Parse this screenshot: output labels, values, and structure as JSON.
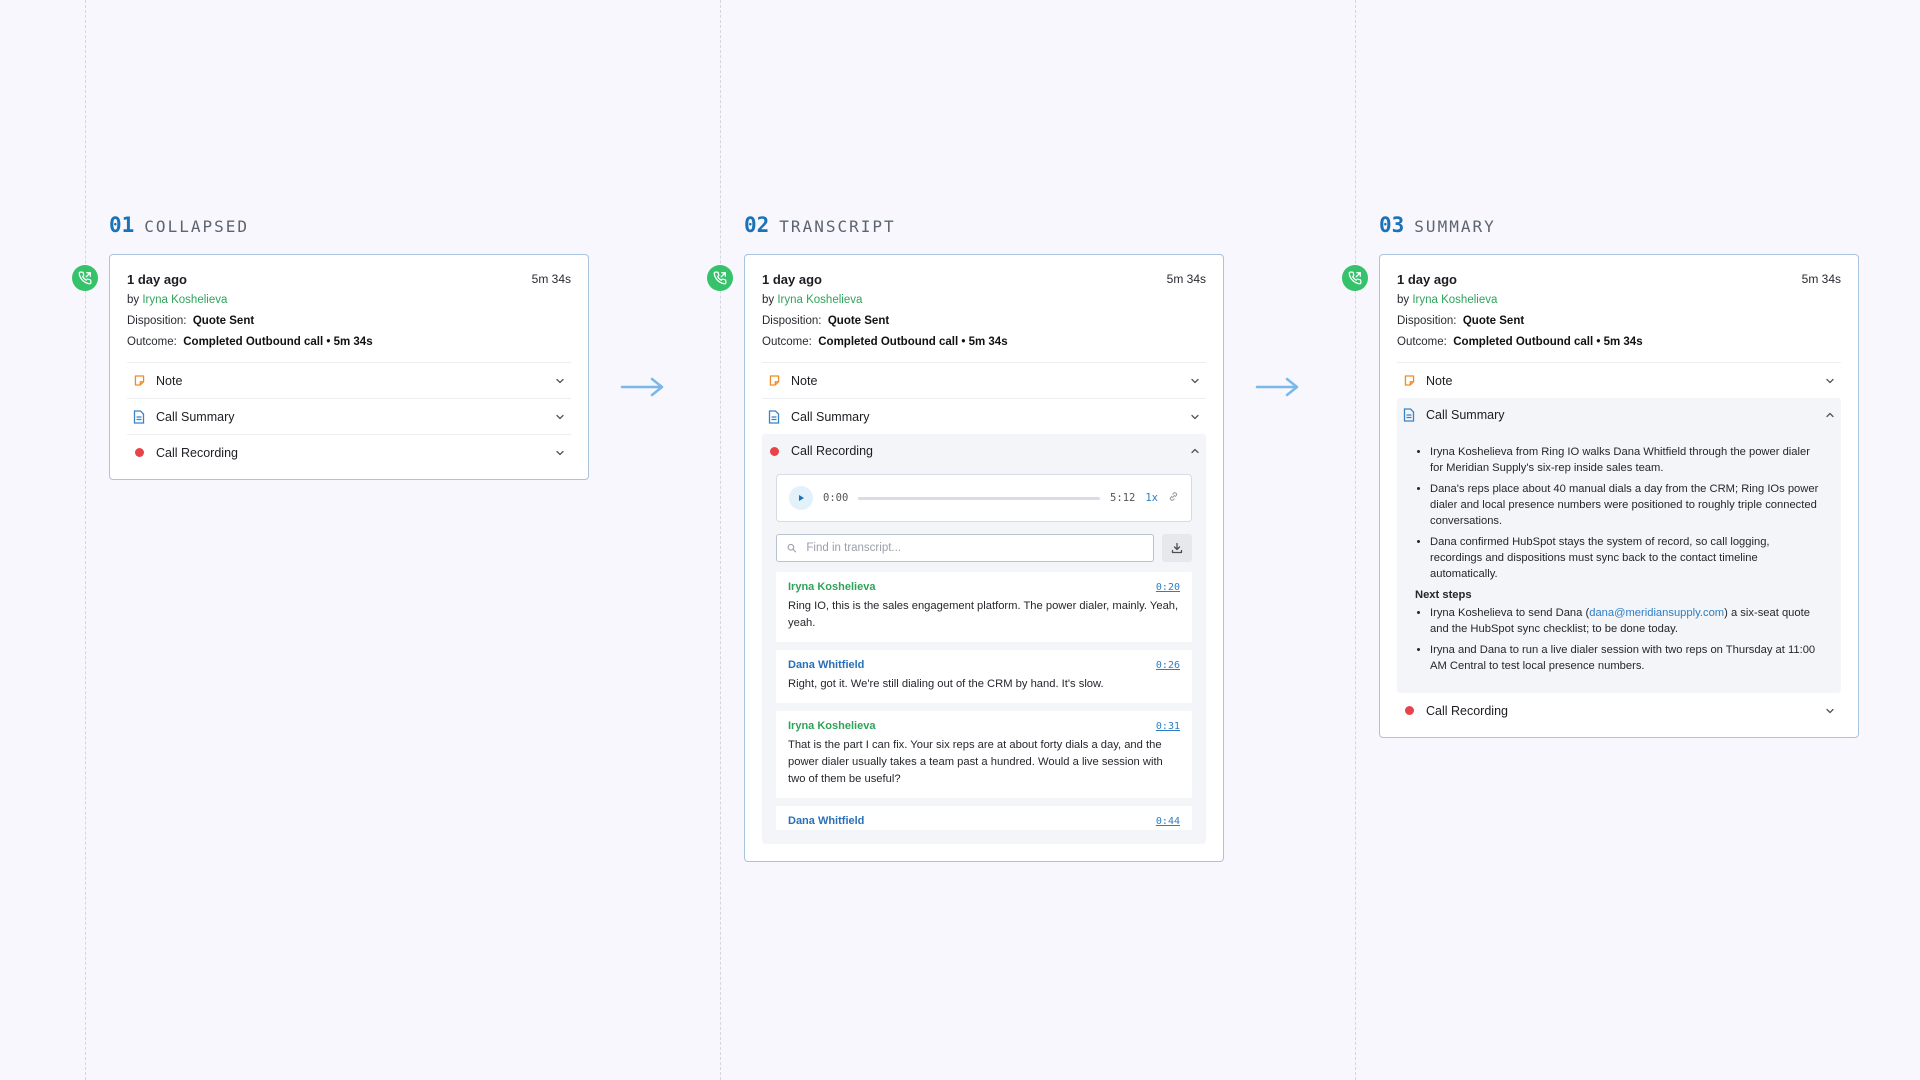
{
  "steps": [
    {
      "num": "01",
      "title": "COLLAPSED"
    },
    {
      "num": "02",
      "title": "TRANSCRIPT"
    },
    {
      "num": "03",
      "title": "SUMMARY"
    }
  ],
  "call": {
    "when": "1 day ago",
    "duration": "5m 34s",
    "by_prefix": "by",
    "agent": "Iryna Koshelieva",
    "disposition_label": "Disposition:",
    "disposition": "Quote Sent",
    "outcome_label": "Outcome:",
    "outcome": "Completed Outbound call • 5m 34s"
  },
  "sections": {
    "note": "Note",
    "summary": "Call Summary",
    "recording": "Call Recording"
  },
  "player": {
    "current": "0:00",
    "total": "5:12",
    "speed": "1x",
    "progress": 0
  },
  "search": {
    "placeholder": "Find in transcript..."
  },
  "transcript": [
    {
      "speaker": "Iryna Koshelieva",
      "color": "green",
      "time": "0:20",
      "text": "Ring IO, this is the sales engagement platform.  The power dialer, mainly.  Yeah, yeah."
    },
    {
      "speaker": "Dana Whitfield",
      "color": "blue",
      "time": "0:26",
      "text": "Right, got it.  We're still dialing out of the CRM by hand.  It's slow."
    },
    {
      "speaker": "Iryna Koshelieva",
      "color": "green",
      "time": "0:31",
      "text": "That is the part I can fix.  Your six reps are at about forty dials a day, and the power dialer usually takes a team past a hundred.  Would a live session with two of them be useful?"
    },
    {
      "speaker": "Dana Whitfield",
      "color": "blue",
      "time": "0:44",
      "text": ""
    }
  ],
  "summary": {
    "bullets": [
      "Iryna Koshelieva from Ring IO walks Dana Whitfield through the power dialer for Meridian Supply's six-rep inside sales team.",
      "Dana's reps place about 40 manual dials a day from the CRM; Ring IOs power dialer and local presence numbers were positioned to roughly triple connected conversations.",
      "Dana confirmed HubSpot stays the system of record, so call logging, recordings and dispositions must sync back to the contact timeline automatically."
    ],
    "next_steps_title": "Next steps",
    "next1_pre": "Iryna Koshelieva to send Dana (",
    "next1_email": "dana@meridiansupply.com",
    "next1_post": ") a six-seat quote and the HubSpot sync checklist; to be done today.",
    "next2": "Iryna and Dana to run a live dialer session with two reps on Thursday at 11:00 AM Central to test local presence numbers."
  },
  "colors": {
    "accent": "#1b72b8",
    "agent_green": "#2fa35a",
    "badge_green": "#36c26a",
    "recording_red": "#e8424a",
    "note_orange": "#f08a24",
    "doc_blue": "#3a82c6",
    "arrow_blue": "#7ab8ea"
  },
  "icons": {
    "badge": "phone-call-icon",
    "note": "note-icon",
    "summary": "document-icon",
    "recording": "record-dot-icon",
    "expand": "chevron-down-icon",
    "collapse": "chevron-up-icon",
    "play": "play-icon",
    "link": "link-icon",
    "search": "search-icon",
    "download": "download-icon",
    "flow": "arrow-right-icon"
  }
}
